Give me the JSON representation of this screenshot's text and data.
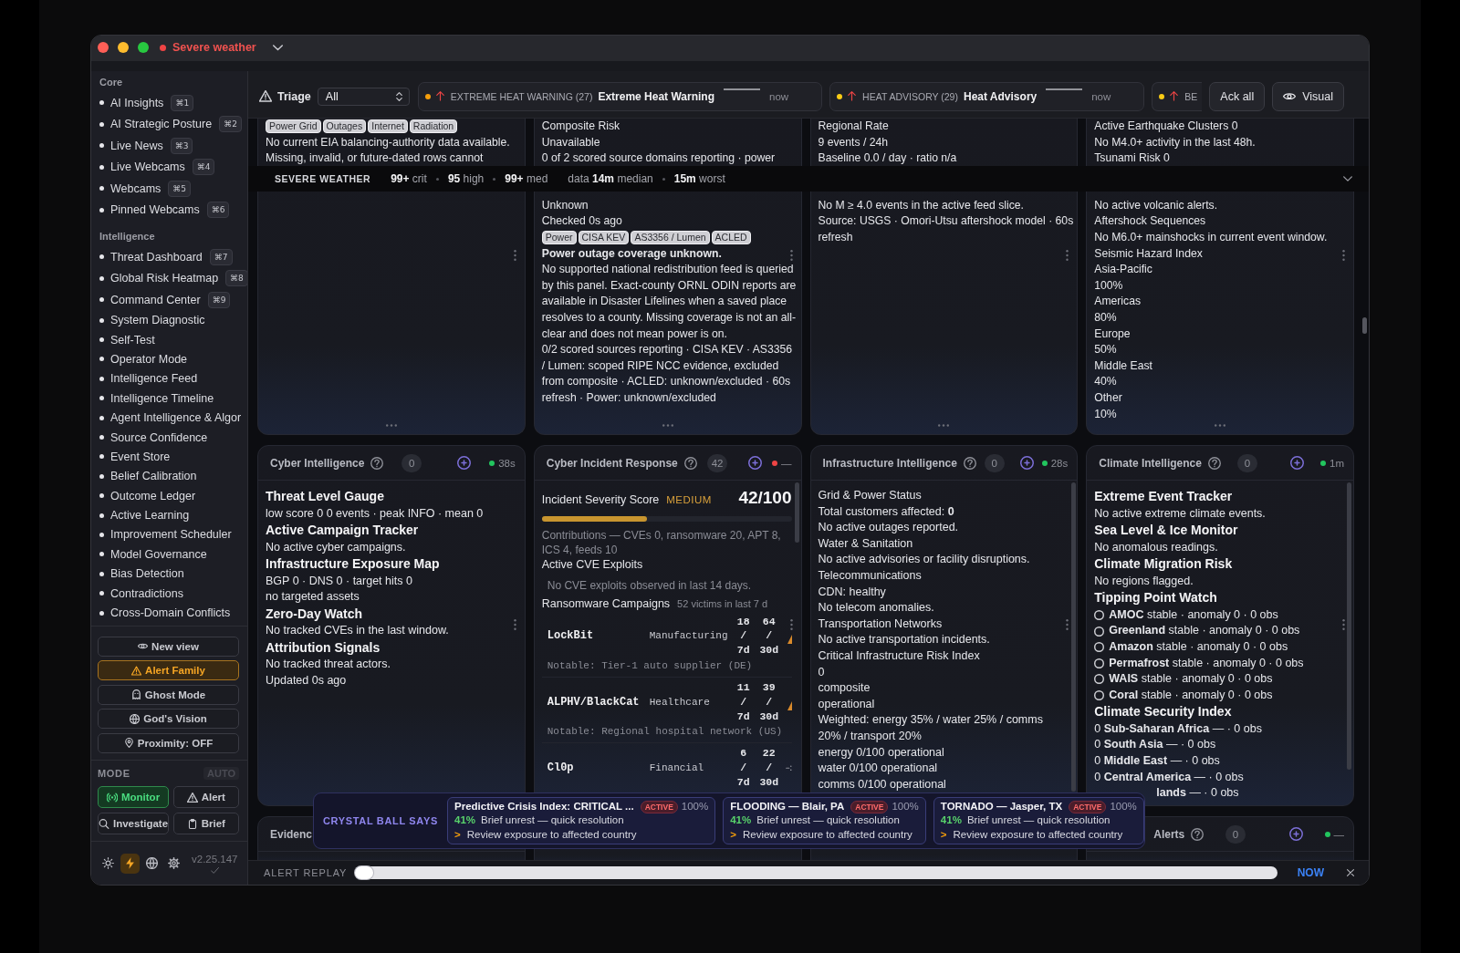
{
  "window": {
    "title": "Severe weather"
  },
  "sidebar": {
    "sections": [
      {
        "label": "Core",
        "items": [
          {
            "label": "AI Insights",
            "shortcut": "⌘1"
          },
          {
            "label": "AI Strategic Posture",
            "shortcut": "⌘2"
          },
          {
            "label": "Live News",
            "shortcut": "⌘3"
          },
          {
            "label": "Live Webcams",
            "shortcut": "⌘4"
          },
          {
            "label": "Webcams",
            "shortcut": "⌘5"
          },
          {
            "label": "Pinned Webcams",
            "shortcut": "⌘6"
          }
        ]
      },
      {
        "label": "Intelligence",
        "items": [
          {
            "label": "Threat Dashboard",
            "shortcut": "⌘7"
          },
          {
            "label": "Global Risk Heatmap",
            "shortcut": "⌘8"
          },
          {
            "label": "Command Center",
            "shortcut": "⌘9"
          },
          {
            "label": "System Diagnostic"
          },
          {
            "label": "Self-Test"
          },
          {
            "label": "Operator Mode"
          },
          {
            "label": "Intelligence Feed"
          },
          {
            "label": "Intelligence Timeline"
          },
          {
            "label": "Agent Intelligence & Algor"
          },
          {
            "label": "Source Confidence"
          },
          {
            "label": "Event Store"
          },
          {
            "label": "Belief Calibration"
          },
          {
            "label": "Outcome Ledger"
          },
          {
            "label": "Active Learning"
          },
          {
            "label": "Improvement Scheduler"
          },
          {
            "label": "Model Governance"
          },
          {
            "label": "Bias Detection"
          },
          {
            "label": "Contradictions"
          },
          {
            "label": "Cross-Domain Conflicts"
          }
        ]
      }
    ],
    "actions": [
      {
        "label": "New view",
        "kind": "eye",
        "on": false
      },
      {
        "label": "Alert Family",
        "kind": "warning",
        "on": true
      },
      {
        "label": "Ghost Mode",
        "kind": "ghost",
        "on": false
      },
      {
        "label": "God's Vision",
        "kind": "globe",
        "on": false
      },
      {
        "label": "Proximity: OFF",
        "kind": "pin",
        "on": false
      }
    ],
    "mode": {
      "label": "MODE",
      "auto": {
        "label": "AUTO",
        "on": false
      },
      "options": [
        {
          "label": "Monitor",
          "kind": "broadcast",
          "selected": true
        },
        {
          "label": "Alert",
          "kind": "warning",
          "selected": false
        },
        {
          "label": "Investigate",
          "kind": "search",
          "selected": false
        },
        {
          "label": "Brief",
          "kind": "clipboard",
          "selected": false
        }
      ]
    },
    "tools": [
      {
        "kind": "sun",
        "selected": false
      },
      {
        "kind": "bolt",
        "selected": true
      },
      {
        "kind": "globe",
        "selected": false
      },
      {
        "kind": "gear",
        "selected": false
      }
    ],
    "version": "v2.25.147"
  },
  "triage": {
    "label": "Triage",
    "filter": "All",
    "alerts": [
      {
        "color": "#f59e0b",
        "category": "EXTREME HEAT WARNING (27)",
        "title": "Extreme Heat Warning",
        "time": "now"
      },
      {
        "color": "#facc15",
        "category": "HEAT ADVISORY (29)",
        "title": "Heat Advisory",
        "time": "now"
      },
      {
        "color": "#facc15",
        "category": "BE"
      }
    ],
    "buttons": [
      {
        "label": "Ack all"
      },
      {
        "label": "Visual",
        "kind": "eye"
      }
    ]
  },
  "summary": {
    "label": "SEVERE WEATHER",
    "counts": [
      "**99+** crit",
      "**95** high",
      "**99+** med"
    ],
    "freshness": [
      "data **14m** median",
      "**15m** worst"
    ]
  },
  "top_panels": [
    {
      "above": [
        {
          "kind": "tags",
          "items": [
            "Power Grid",
            "Outages",
            "Internet",
            "Radiation"
          ]
        },
        {
          "kind": "text",
          "text": "No current EIA balancing-authority data available."
        },
        {
          "kind": "text",
          "text": "Missing, invalid, or future-dated rows cannot"
        }
      ]
    },
    {
      "above": [
        {
          "kind": "text",
          "text": "Composite Risk"
        },
        {
          "kind": "text",
          "text": "Unavailable"
        },
        {
          "kind": "text",
          "text": "0 of 2 scored source domains reporting · power"
        }
      ],
      "below": [
        {
          "kind": "text",
          "text": "Unknown"
        },
        {
          "kind": "text",
          "text": "Checked 0s ago"
        },
        {
          "kind": "tags",
          "items": [
            "Power",
            "CISA KEV",
            "AS3356 / Lumen",
            "ACLED"
          ]
        },
        {
          "kind": "strong",
          "text": "Power outage coverage unknown."
        },
        {
          "kind": "text",
          "text": "No supported national redistribution feed is queried by this panel. Exact-county ORNL ODIN reports are available in Disaster Lifelines when a saved place resolves to a county. Missing coverage is not an all-clear and does not mean power is on."
        },
        {
          "kind": "text",
          "text": "0/2 scored sources reporting · CISA KEV · AS3356 / Lumen: scoped RIPE NCC evidence, excluded from composite · ACLED: unknown/excluded · 60s refresh · Power: unknown/excluded"
        }
      ]
    },
    {
      "above": [
        {
          "kind": "text",
          "text": "Regional Rate"
        },
        {
          "kind": "text",
          "text": "9 events / 24h"
        },
        {
          "kind": "text",
          "text": "Baseline 0.0 / day · ratio n/a"
        }
      ],
      "below": [
        {
          "kind": "text",
          "text": "No M ≥ 4.0 events in the active feed slice."
        },
        {
          "kind": "text",
          "text": "Source: USGS · Omori-Utsu aftershock model · 60s refresh"
        }
      ]
    },
    {
      "above": [
        {
          "kind": "text",
          "text": "Active Earthquake Clusters 0"
        },
        {
          "kind": "text",
          "text": "No M4.0+ activity in the last 48h."
        },
        {
          "kind": "text",
          "text": "Tsunami Risk 0"
        }
      ],
      "below": [
        {
          "kind": "text",
          "text": "No active volcanic alerts."
        },
        {
          "kind": "text",
          "text": "Aftershock Sequences"
        },
        {
          "kind": "text",
          "text": "No M6.0+ mainshocks in current event window."
        },
        {
          "kind": "text",
          "text": "Seismic Hazard Index"
        },
        {
          "kind": "text",
          "text": "Asia-Pacific"
        },
        {
          "kind": "text",
          "text": "100%"
        },
        {
          "kind": "text",
          "text": "Americas"
        },
        {
          "kind": "text",
          "text": "80%"
        },
        {
          "kind": "text",
          "text": "Europe"
        },
        {
          "kind": "text",
          "text": "50%"
        },
        {
          "kind": "text",
          "text": "Middle East"
        },
        {
          "kind": "text",
          "text": "40%"
        },
        {
          "kind": "text",
          "text": "Other"
        },
        {
          "kind": "text",
          "text": "10%"
        }
      ]
    }
  ],
  "panels": [
    {
      "title": "Cyber Intelligence",
      "count": "0",
      "status": {
        "age": "38s",
        "color": "#22c55e"
      },
      "blocks": [
        {
          "kind": "heading",
          "text": "Threat Level Gauge"
        },
        {
          "kind": "text",
          "text": "low score 0 0 events · peak INFO · mean 0"
        },
        {
          "kind": "heading",
          "text": "Active Campaign Tracker"
        },
        {
          "kind": "text",
          "text": "No active cyber campaigns."
        },
        {
          "kind": "heading",
          "text": "Infrastructure Exposure Map"
        },
        {
          "kind": "text",
          "text": "BGP 0 · DNS 0 · target hits 0"
        },
        {
          "kind": "text",
          "text": "no targeted assets"
        },
        {
          "kind": "heading",
          "text": "Zero-Day Watch"
        },
        {
          "kind": "text",
          "text": "No tracked CVEs in the last window."
        },
        {
          "kind": "heading",
          "text": "Attribution Signals"
        },
        {
          "kind": "text",
          "text": "No tracked threat actors."
        },
        {
          "kind": "text",
          "text": "Updated 0s ago"
        }
      ]
    },
    {
      "title": "Cyber Incident Response",
      "count": "42",
      "status": {
        "age": "—",
        "color": "#ef4444"
      },
      "blocks": [
        {
          "kind": "score",
          "label": "Incident Severity Score",
          "severity": "MEDIUM",
          "value": "42/100",
          "level": 0.42
        },
        {
          "kind": "muted",
          "text": "Contributions — CVEs 0, ransomware 20, APT 8, ICS 4, feeds 10"
        },
        {
          "kind": "text",
          "text": "Active CVE Exploits"
        },
        {
          "kind": "note",
          "text": "No CVE exploits observed in last 14 days."
        },
        {
          "kind": "section",
          "text": "Ransomware Campaigns",
          "note": "52 victims in last 7 d"
        },
        {
          "kind": "campaign",
          "name": "LockBit",
          "sector": "Manufacturing",
          "week": "18 / 7d",
          "month": "64 / 30d",
          "trend": {
            "kind": "rising"
          },
          "notable": "Notable: Tier-1 auto supplier (DE)"
        },
        {
          "kind": "campaign",
          "name": "ALPHV/BlackCat",
          "sector": "Healthcare",
          "week": "11 / 7d",
          "month": "39 / 30d",
          "trend": {
            "kind": "rising"
          },
          "notable": "Notable: Regional hospital network (US)"
        },
        {
          "kind": "campaign",
          "name": "Cl0p",
          "sector": "Financial",
          "week": "6 / 7d",
          "month": "22 / 30d",
          "trend": {
            "kind": "flat"
          }
        }
      ]
    },
    {
      "title": "Infrastructure Intelligence",
      "count": "0",
      "status": {
        "age": "28s",
        "color": "#22c55e"
      },
      "blocks": [
        {
          "kind": "text",
          "text": "Grid & Power Status"
        },
        {
          "kind": "text",
          "text": "Total customers affected: **0**"
        },
        {
          "kind": "text",
          "text": "No active outages reported."
        },
        {
          "kind": "text",
          "text": "Water & Sanitation"
        },
        {
          "kind": "text",
          "text": "No active advisories or facility disruptions."
        },
        {
          "kind": "text",
          "text": "Telecommunications"
        },
        {
          "kind": "text",
          "text": "CDN: healthy"
        },
        {
          "kind": "text",
          "text": "No telecom anomalies."
        },
        {
          "kind": "text",
          "text": "Transportation Networks"
        },
        {
          "kind": "text",
          "text": "No active transportation incidents."
        },
        {
          "kind": "text",
          "text": "Critical Infrastructure Risk Index"
        },
        {
          "kind": "text",
          "text": "0"
        },
        {
          "kind": "text",
          "text": "composite"
        },
        {
          "kind": "text",
          "text": "operational"
        },
        {
          "kind": "text",
          "text": "Weighted: energy 35% / water 25% / comms 20% / transport 20%"
        },
        {
          "kind": "text",
          "text": "energy 0/100 operational"
        },
        {
          "kind": "text",
          "text": "water 0/100 operational"
        },
        {
          "kind": "text",
          "text": "comms 0/100 operational"
        }
      ]
    },
    {
      "title": "Climate Intelligence",
      "count": "0",
      "status": {
        "age": "1m",
        "color": "#22c55e"
      },
      "blocks": [
        {
          "kind": "heading",
          "text": "Extreme Event Tracker"
        },
        {
          "kind": "text",
          "text": "No active extreme climate events."
        },
        {
          "kind": "heading",
          "text": "Sea Level & Ice Monitor"
        },
        {
          "kind": "text",
          "text": "No anomalous readings."
        },
        {
          "kind": "heading",
          "text": "Climate Migration Risk"
        },
        {
          "kind": "text",
          "text": "No regions flagged."
        },
        {
          "kind": "heading",
          "text": "Tipping Point Watch"
        },
        {
          "kind": "tipping",
          "text": "**AMOC** stable · anomaly 0 · 0 obs"
        },
        {
          "kind": "tipping",
          "text": "**Greenland** stable · anomaly 0 · 0 obs"
        },
        {
          "kind": "tipping",
          "text": "**Amazon** stable · anomaly 0 · 0 obs"
        },
        {
          "kind": "tipping",
          "text": "**Permafrost** stable · anomaly 0 · 0 obs"
        },
        {
          "kind": "tipping",
          "text": "**WAIS** stable · anomaly 0 · 0 obs"
        },
        {
          "kind": "tipping",
          "text": "**Coral** stable · anomaly 0 · 0 obs"
        },
        {
          "kind": "heading",
          "text": "Climate Security Index"
        },
        {
          "kind": "text",
          "text": "0 **Sub-Saharan Africa** — · 0 obs"
        },
        {
          "kind": "text",
          "text": "0 **South Asia** — · 0 obs"
        },
        {
          "kind": "text",
          "text": "0 **Middle East** — · 0 obs"
        },
        {
          "kind": "text",
          "text": "0 **Central America** — · 0 obs"
        },
        {
          "kind": "text",
          "text": "**lands** — · 0 obs",
          "covered": true
        }
      ]
    }
  ],
  "lower_panels": [
    {
      "title": "Evidenc"
    },
    {
      "title": "Alerts",
      "count": "0",
      "status": {
        "age": "—",
        "color": "#22c55e"
      },
      "covered": true
    }
  ],
  "crystal_ball": {
    "label": "CRYSTAL BALL SAYS",
    "cards": [
      {
        "title": "Predictive Crisis Index: CRITICAL ...",
        "badge": "ACTIVE",
        "confidence": "100%",
        "probability": "41%",
        "outcome": "Brief unrest — quick resolution",
        "marker": ">",
        "action": "Review exposure to affected country"
      },
      {
        "title": "FLOODING — Blair, PA",
        "badge": "ACTIVE",
        "confidence": "100%",
        "probability": "41%",
        "outcome": "Brief unrest — quick resolution",
        "marker": ">",
        "action": "Review exposure to affected country"
      },
      {
        "title": "TORNADO — Jasper, TX",
        "badge": "ACTIVE",
        "confidence": "100%",
        "probability": "41%",
        "outcome": "Brief unrest — quick resolution",
        "marker": ">",
        "action": "Review exposure to affected country"
      }
    ]
  },
  "replay": {
    "label": "ALERT REPLAY",
    "level": 0,
    "now": "NOW"
  }
}
